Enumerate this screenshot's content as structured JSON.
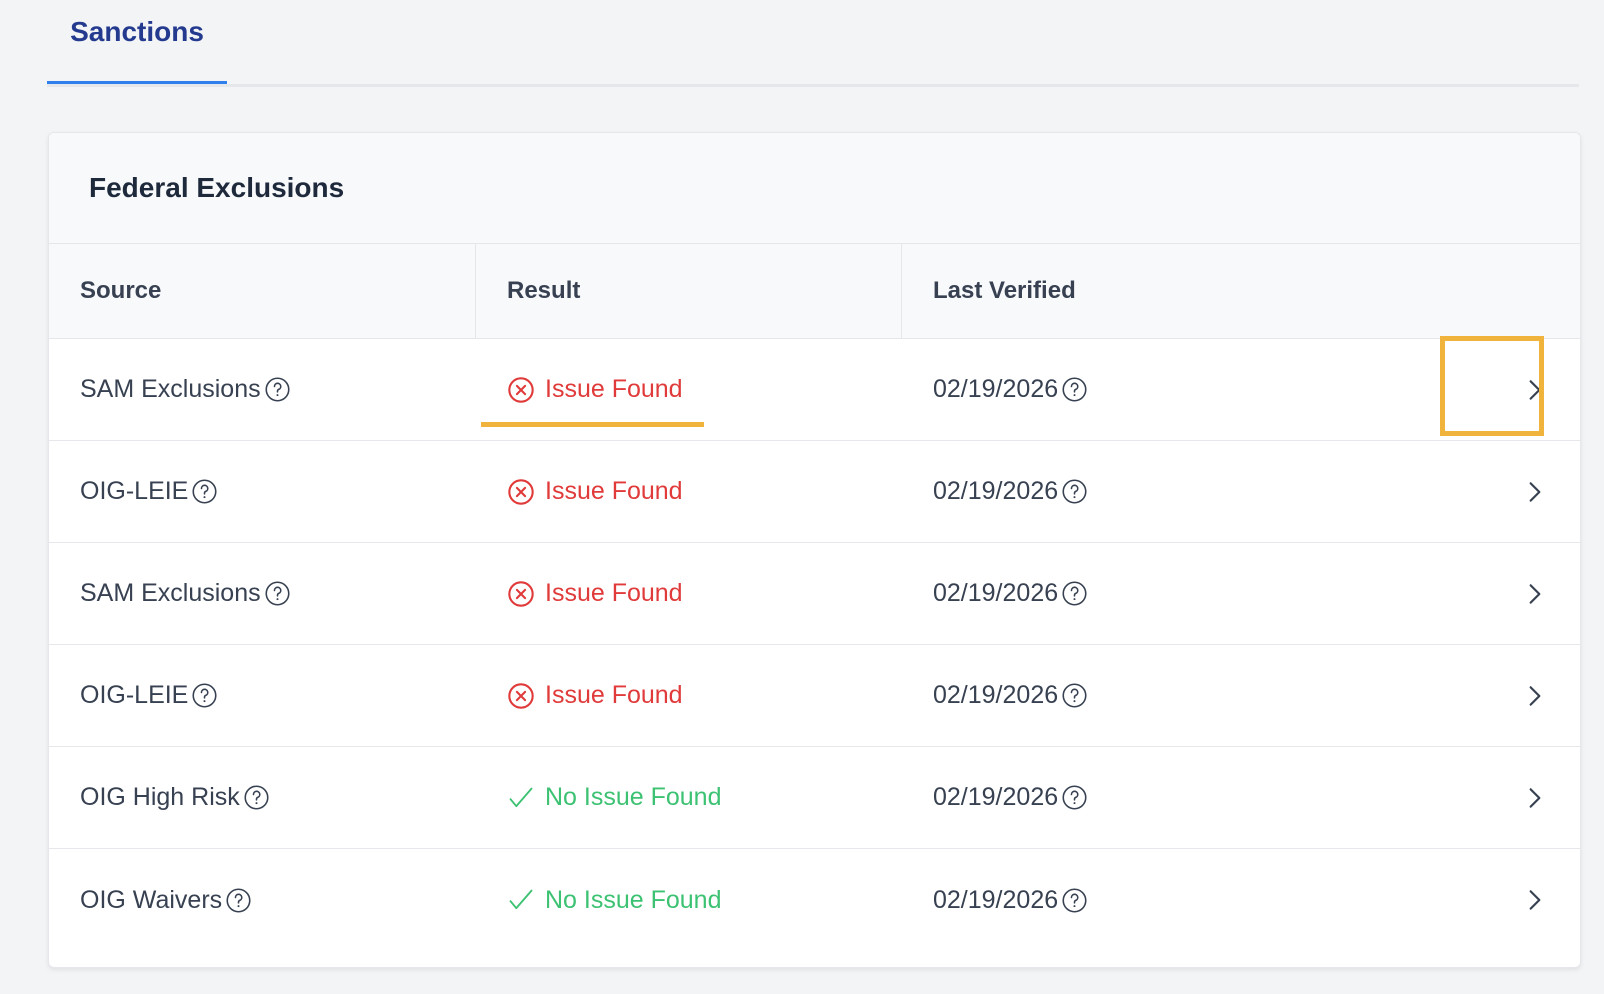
{
  "tabs": {
    "active_label": "Sanctions"
  },
  "card": {
    "title": "Federal Exclusions"
  },
  "table": {
    "headers": {
      "source": "Source",
      "result": "Result",
      "last_verified": "Last Verified"
    },
    "rows": [
      {
        "source": "SAM Exclusions",
        "result": "Issue Found",
        "status": "issue",
        "last_verified": "02/19/2026"
      },
      {
        "source": "OIG-LEIE",
        "result": "Issue Found",
        "status": "issue",
        "last_verified": "02/19/2026"
      },
      {
        "source": "SAM Exclusions",
        "result": "Issue Found",
        "status": "issue",
        "last_verified": "02/19/2026"
      },
      {
        "source": "OIG-LEIE",
        "result": "Issue Found",
        "status": "issue",
        "last_verified": "02/19/2026"
      },
      {
        "source": "OIG High Risk",
        "result": "No Issue Found",
        "status": "ok",
        "last_verified": "02/19/2026"
      },
      {
        "source": "OIG Waivers",
        "result": "No Issue Found",
        "status": "ok",
        "last_verified": "02/19/2026"
      }
    ]
  },
  "icons": {
    "help": "question-circle-icon",
    "issue": "x-circle-icon",
    "ok": "check-icon",
    "row_action": "chevron-right-icon"
  },
  "colors": {
    "tab_active_text": "#233a8f",
    "tab_indicator": "#2f80ed",
    "issue": "#e03a3a",
    "ok": "#3cc272",
    "annotation": "#f0b43c"
  }
}
